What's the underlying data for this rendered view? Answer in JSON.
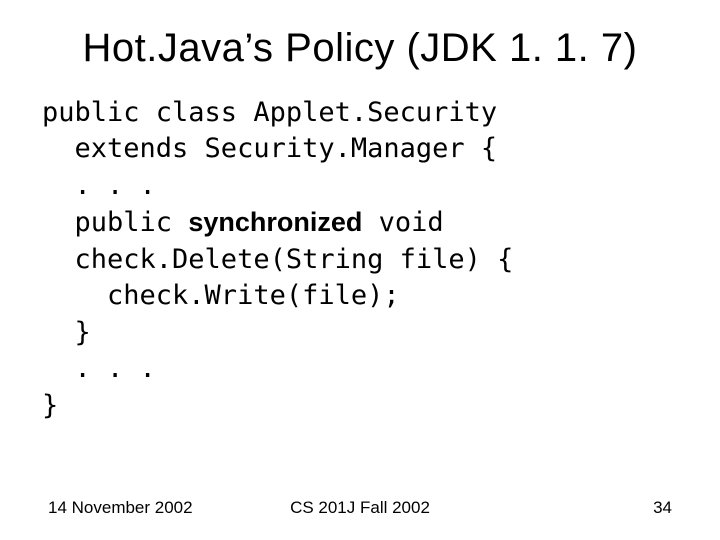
{
  "title": "Hot.Java’s Policy (JDK 1. 1. 7)",
  "code": {
    "l1": "public class Applet.Security",
    "l2": "  extends Security.Manager {",
    "l3": "  . . .",
    "l4a": "  public ",
    "l4b": "synchronized",
    "l4c": " void",
    "l5": "  check.Delete(String file) {",
    "l6": "    check.Write(file);",
    "l7": "  }",
    "l8": "  . . .",
    "l9": "}"
  },
  "footer": {
    "left": "14 November 2002",
    "center": "CS 201J Fall 2002",
    "right": "34"
  }
}
